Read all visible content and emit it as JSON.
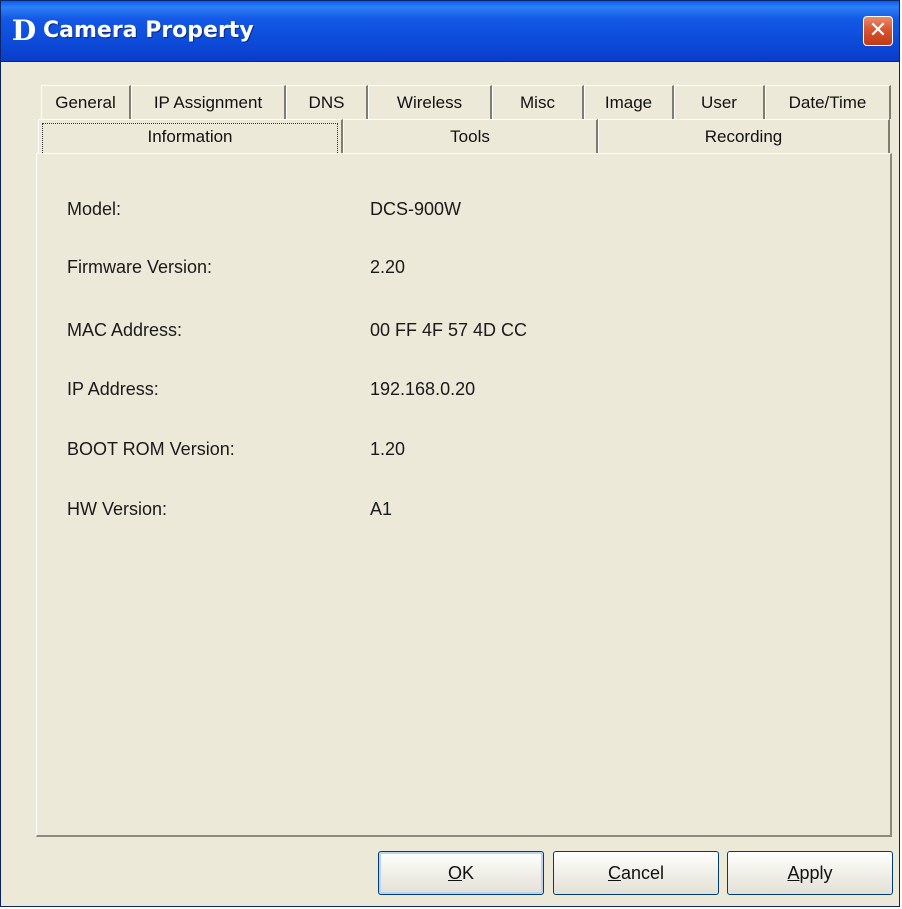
{
  "window": {
    "logo": "D",
    "title": "Camera Property",
    "close_glyph": "✕",
    "close_icon": "close-icon",
    "colors": {
      "titlebar": "#0c4ad8",
      "close_button": "#d8552f",
      "body": "#ece9d8"
    }
  },
  "tabs_row1": [
    {
      "label": "General"
    },
    {
      "label": "IP Assignment"
    },
    {
      "label": "DNS"
    },
    {
      "label": "Wireless"
    },
    {
      "label": "Misc"
    },
    {
      "label": "Image"
    },
    {
      "label": "User"
    },
    {
      "label": "Date/Time"
    }
  ],
  "tabs_row2": [
    {
      "label": "Information",
      "active": true
    },
    {
      "label": "Tools",
      "active": false
    },
    {
      "label": "Recording",
      "active": false
    }
  ],
  "info": [
    {
      "label": "Model:",
      "value": "DCS-900W"
    },
    {
      "label": "Firmware Version:",
      "value": "2.20"
    },
    {
      "label": "MAC Address:",
      "value": "00 FF 4F 57 4D CC"
    },
    {
      "label": "IP Address:",
      "value": "192.168.0.20"
    },
    {
      "label": "BOOT ROM Version:",
      "value": "1.20"
    },
    {
      "label": "HW Version:",
      "value": "A1"
    }
  ],
  "buttons": {
    "ok": {
      "mnemonic": "O",
      "rest": "K"
    },
    "cancel": {
      "mnemonic": "C",
      "rest": "ancel"
    },
    "apply": {
      "mnemonic": "A",
      "rest": "pply"
    }
  }
}
